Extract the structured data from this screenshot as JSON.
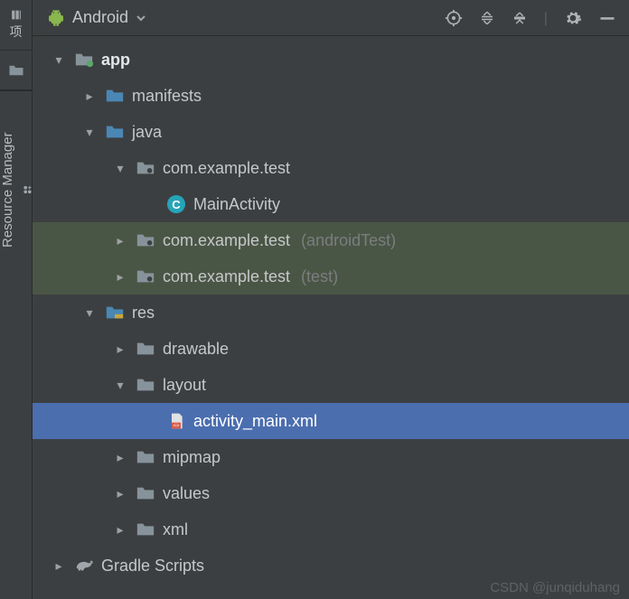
{
  "rail": {
    "project_cjk": "项",
    "resource_manager": "Resource Manager"
  },
  "toolbar": {
    "view_label": "Android"
  },
  "tree": {
    "app": "app",
    "manifests": "manifests",
    "java": "java",
    "pkg_main": "com.example.test",
    "main_activity": "MainActivity",
    "pkg_androidTest": "com.example.test",
    "pkg_androidTest_suffix": "(androidTest)",
    "pkg_test": "com.example.test",
    "pkg_test_suffix": "(test)",
    "res": "res",
    "drawable": "drawable",
    "layout": "layout",
    "activity_main": "activity_main.xml",
    "mipmap": "mipmap",
    "values": "values",
    "xml": "xml",
    "gradle": "Gradle Scripts"
  },
  "watermark": "CSDN @junqiduhang"
}
